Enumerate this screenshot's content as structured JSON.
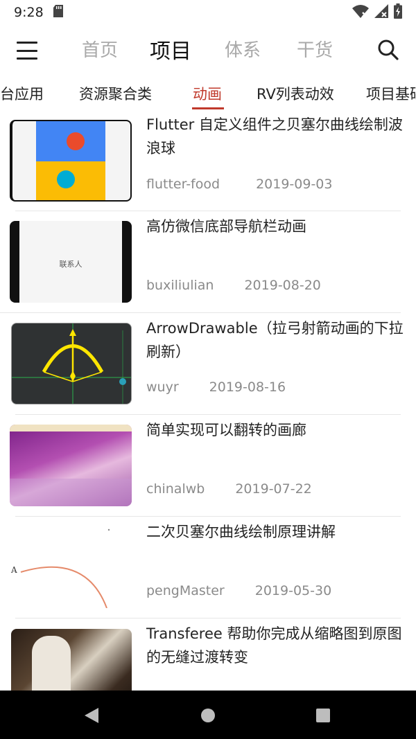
{
  "status_bar": {
    "time": "9:28",
    "icons": [
      "sd-card-icon",
      "wifi-x-icon",
      "signal-x-icon",
      "battery-charging-icon"
    ]
  },
  "app_bar": {
    "tabs": [
      {
        "label": "首页",
        "active": false
      },
      {
        "label": "项目",
        "active": true
      },
      {
        "label": "体系",
        "active": false
      },
      {
        "label": "干货",
        "active": false
      }
    ]
  },
  "category_tabs": [
    {
      "label": "跨平台应用",
      "active": false
    },
    {
      "label": "资源聚合类",
      "active": false
    },
    {
      "label": "动画",
      "active": true
    },
    {
      "label": "RV列表动效",
      "active": false
    },
    {
      "label": "项目基础功能",
      "active": false
    }
  ],
  "articles": [
    {
      "title": "Flutter 自定义组件之贝塞尔曲线绘制波浪球",
      "author": "flutter-food",
      "date": "2019-09-03"
    },
    {
      "title": "高仿微信底部导航栏动画",
      "author": "buxiliulian",
      "date": "2019-08-20",
      "thumb_text": "联系人"
    },
    {
      "title": "ArrowDrawable（拉弓射箭动画的下拉刷新）",
      "author": "wuyr",
      "date": "2019-08-16"
    },
    {
      "title": "简单实现可以翻转的画廊",
      "author": "chinalwb",
      "date": "2019-07-22"
    },
    {
      "title": "二次贝塞尔曲线绘制原理讲解",
      "author": "pengMaster",
      "date": "2019-05-30",
      "thumb_text": "A"
    },
    {
      "title": "Transferee 帮助你完成从缩略图到原图的无缝过渡转变",
      "author": "",
      "date": ""
    }
  ],
  "colors": {
    "accent": "#c0392b",
    "inactive_tab": "#a9a9a9",
    "meta_text": "#8a8a8a"
  }
}
